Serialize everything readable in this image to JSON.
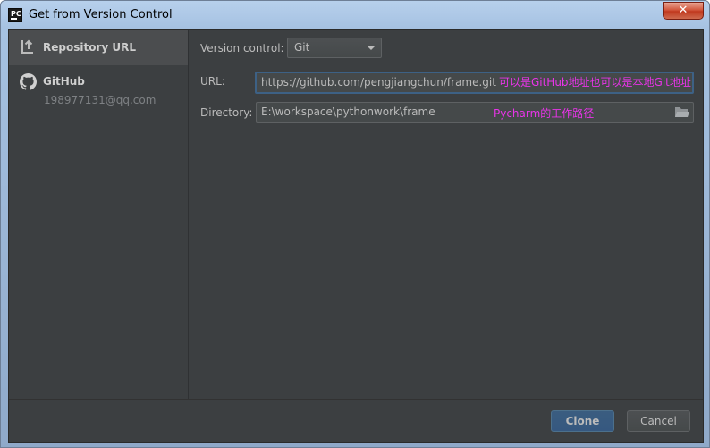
{
  "window": {
    "title": "Get from Version Control",
    "app_icon_text": "PC",
    "close_glyph": "✕"
  },
  "sidebar": {
    "items": [
      {
        "label": "Repository URL",
        "icon": "repository-url-icon",
        "selected": true
      },
      {
        "label": "GitHub",
        "icon": "github-icon",
        "sublabel": "198977131@qq.com",
        "selected": false
      }
    ]
  },
  "form": {
    "version_control": {
      "label": "Version control:",
      "value": "Git"
    },
    "url": {
      "label": "URL:",
      "value": "https://github.com/pengjiangchun/frame.git",
      "annotation": "可以是GitHub地址也可以是本地Git地址"
    },
    "directory": {
      "label": "Directory:",
      "value": "E:\\workspace\\pythonwork\\frame",
      "annotation": "Pycharm的工作路径",
      "browse_icon": "folder-icon"
    }
  },
  "buttons": {
    "clone_label": "Clone",
    "cancel_label": "Cancel"
  },
  "colors": {
    "panel_bg": "#3c3f41",
    "selected_item_bg": "#4b4d4f",
    "input_bg": "#45494a",
    "focus_border": "#3d6185",
    "annotation_text": "#e934e9",
    "primary_button": "#365880"
  }
}
